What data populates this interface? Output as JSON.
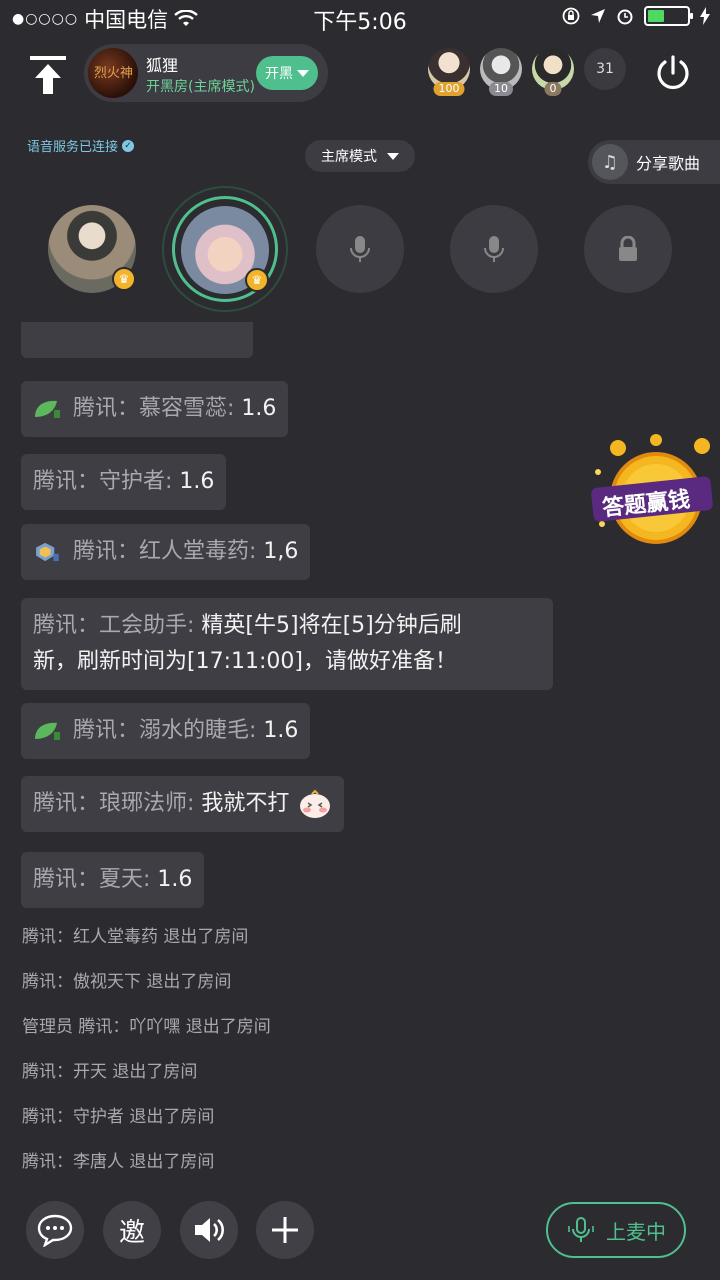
{
  "status_bar": {
    "carrier": "中国电信",
    "time": "下午5:06"
  },
  "room": {
    "avatar_text": "烈火神",
    "name": "狐狸",
    "mode": "开黑房(主席模式)",
    "mode_button": "开黑"
  },
  "top_users": [
    {
      "badge": "100"
    },
    {
      "badge": "10"
    },
    {
      "badge": "0"
    }
  ],
  "online_count": "31",
  "voice_status": "语音服务已连接",
  "seat_mode": "主席模式",
  "share_song": "分享歌曲",
  "chat": [
    {
      "sender": "腾讯：慕容雪蕊:",
      "msg": " 1.6",
      "badge": "leaf"
    },
    {
      "sender": "腾讯：守护者:",
      "msg": " 1.6",
      "badge": ""
    },
    {
      "sender": "腾讯：红人堂毒药:",
      "msg": " 1,6",
      "badge": "rank"
    },
    {
      "sender": "腾讯：工会助手:",
      "msg": " 精英[牛5]将在[5]分钟后刷",
      "msg2": "新，刷新时间为[17:11:00]，请做好准备！",
      "badge": ""
    },
    {
      "sender": "腾讯：溺水的睫毛:",
      "msg": " 1.6",
      "badge": "leaf"
    },
    {
      "sender": "腾讯：琅琊法师:",
      "msg": " 我就不打",
      "badge": ""
    },
    {
      "sender": "腾讯：夏天:",
      "msg": " 1.6",
      "badge": ""
    }
  ],
  "system_msgs": [
    "腾讯：红人堂毒药 退出了房间",
    "腾讯：傲视天下 退出了房间",
    "管理员 腾讯：吖吖嘿 退出了房间",
    "腾讯：开天 退出了房间",
    "腾讯：守护者 退出了房间",
    "腾讯：李唐人 退出了房间"
  ],
  "quiz_badge": "答题赢钱",
  "bottom": {
    "invite": "邀",
    "mic_up": "上麦中"
  },
  "colors": {
    "accent": "#4fc08d",
    "background": "#2b2b30",
    "bubble": "#3e3e44"
  }
}
